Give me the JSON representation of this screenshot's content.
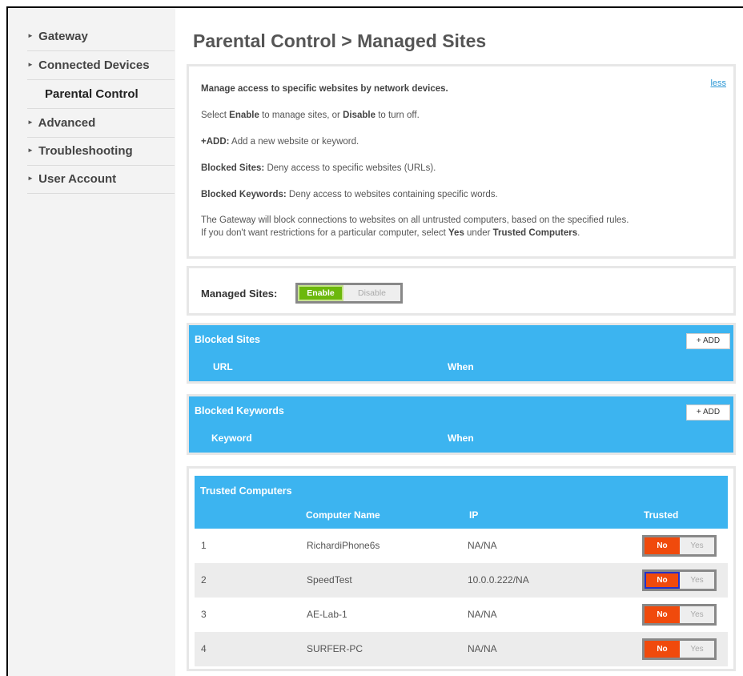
{
  "sidebar": {
    "items": [
      {
        "label": "Gateway",
        "arrow": true
      },
      {
        "label": "Connected Devices",
        "arrow": true
      },
      {
        "label": "Parental Control",
        "arrow": false
      },
      {
        "label": "Advanced",
        "arrow": true
      },
      {
        "label": "Troubleshooting",
        "arrow": true
      },
      {
        "label": "User Account",
        "arrow": true
      }
    ]
  },
  "page": {
    "title": "Parental Control > Managed Sites"
  },
  "description": {
    "less_link": "less",
    "intro": "Manage access to specific websites by network devices.",
    "enable_line": {
      "a": "Select ",
      "b": "Enable",
      "c": " to manage sites, or ",
      "d": "Disable",
      "e": " to turn off."
    },
    "add_line": {
      "b": "+ADD:",
      "rest": " Add a new website or keyword."
    },
    "blocked_sites_line": {
      "b": "Blocked Sites:",
      "rest": " Deny access to specific websites (URLs)."
    },
    "blocked_keywords_line": {
      "b": "Blocked Keywords:",
      "rest": " Deny access to websites containing specific words."
    },
    "gateway_line1": "The Gateway will block connections to websites on all untrusted computers, based on the specified rules.",
    "gateway_line2": {
      "a": "If you don't want restrictions for a particular computer, select ",
      "b": "Yes",
      "c": " under ",
      "d": "Trusted Computers",
      "e": "."
    }
  },
  "managed_sites": {
    "label": "Managed Sites:",
    "enable": "Enable",
    "disable": "Disable",
    "selected": "Enable"
  },
  "blocked_sites": {
    "title": "Blocked Sites",
    "add": "+ ADD",
    "columns": [
      "URL",
      "When"
    ]
  },
  "blocked_keywords": {
    "title": "Blocked Keywords",
    "add": "+ ADD",
    "columns": [
      "Keyword",
      "When"
    ]
  },
  "trusted_computers": {
    "title": "Trusted Computers",
    "columns": [
      "Computer Name",
      "IP",
      "Trusted"
    ],
    "rows": [
      {
        "num": "1",
        "name": "RichardiPhone6s",
        "ip": "NA/NA",
        "no": "No",
        "yes": "Yes"
      },
      {
        "num": "2",
        "name": "SpeedTest",
        "ip": "10.0.0.222/NA",
        "no": "No",
        "yes": "Yes"
      },
      {
        "num": "3",
        "name": "AE-Lab-1",
        "ip": "NA/NA",
        "no": "No",
        "yes": "Yes"
      },
      {
        "num": "4",
        "name": "SURFER-PC",
        "ip": "NA/NA",
        "no": "No",
        "yes": "Yes"
      }
    ]
  },
  "colors": {
    "accent_blue": "#3cb4f0",
    "enable_green": "#6cb80c",
    "no_orange": "#f04a0c",
    "link": "#2b97d5"
  }
}
